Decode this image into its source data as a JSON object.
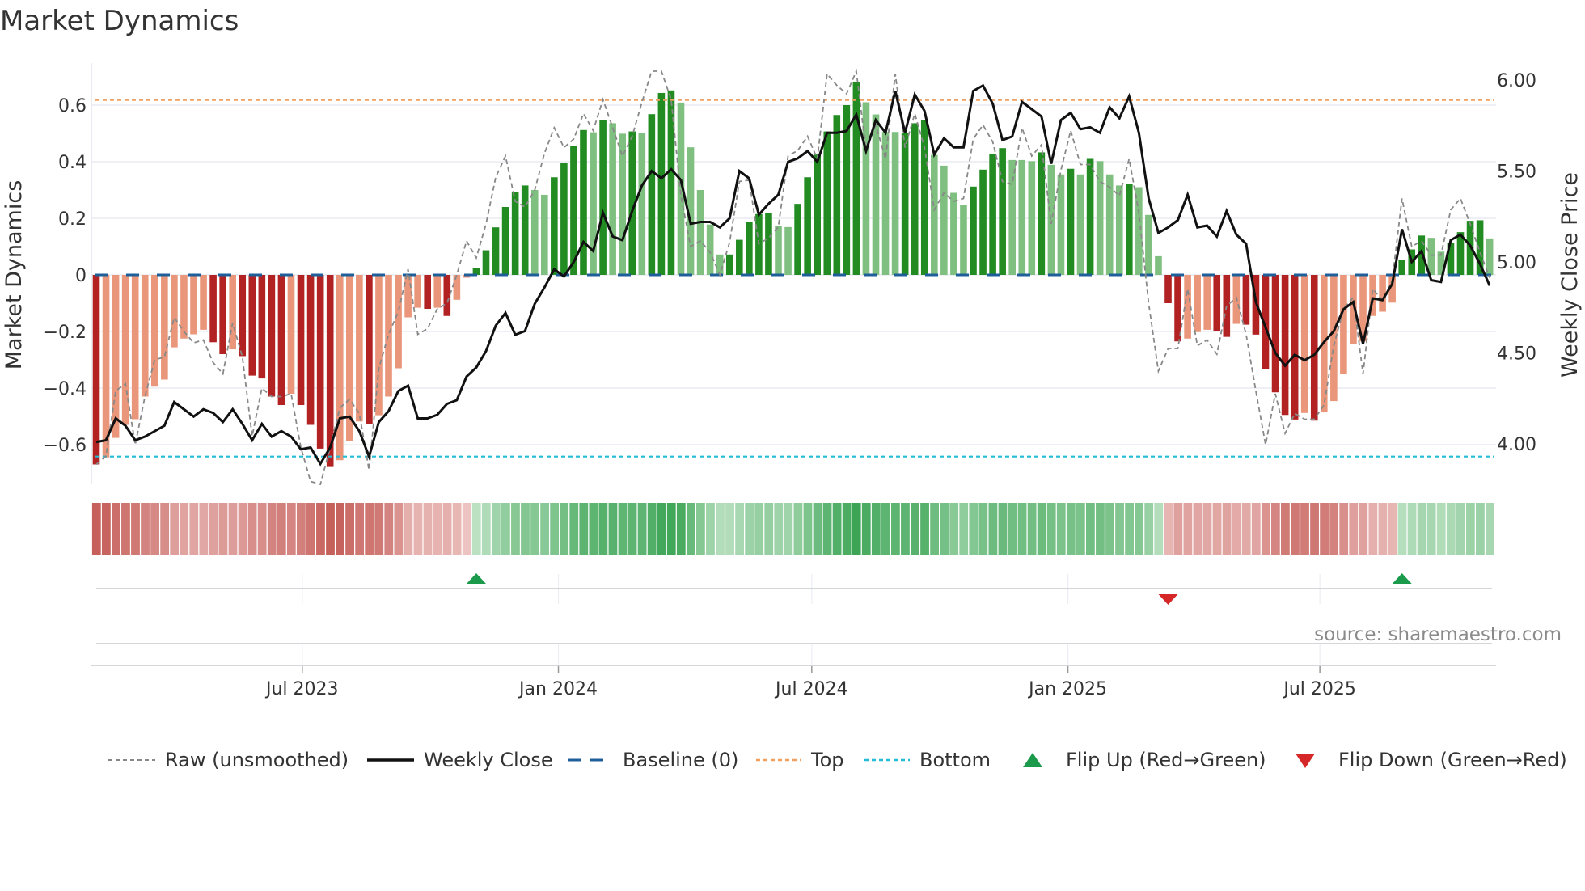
{
  "title": "Market Dynamics",
  "source": "source: sharemaestro.com",
  "chart_data": {
    "type": "bar",
    "title": "Market Dynamics",
    "frequency": "weekly",
    "start_date": "2023-02-03",
    "ylabel": "Market Dynamics",
    "y2label": "Weekly Close Price",
    "ylim": [
      -0.75,
      0.75
    ],
    "y2lim": [
      3.82,
      6.1
    ],
    "yticks": [
      {
        "v": 0.6,
        "label": "0.6"
      },
      {
        "v": 0.4,
        "label": "0.4"
      },
      {
        "v": 0.2,
        "label": "0.2"
      },
      {
        "v": 0,
        "label": "0"
      },
      {
        "v": -0.2,
        "label": "−0.2"
      },
      {
        "v": -0.4,
        "label": "−0.4"
      },
      {
        "v": -0.6,
        "label": "−0.6"
      }
    ],
    "y2ticks": [
      {
        "v": 6.0,
        "label": "6.00"
      },
      {
        "v": 5.5,
        "label": "5.50"
      },
      {
        "v": 5.0,
        "label": "5.00"
      },
      {
        "v": 4.5,
        "label": "4.50"
      },
      {
        "v": 4.0,
        "label": "4.00"
      }
    ],
    "xticks": [
      {
        "date": "2023-07-01",
        "label": "Jul 2023"
      },
      {
        "date": "2024-01-01",
        "label": "Jan 2024"
      },
      {
        "date": "2024-07-01",
        "label": "Jul 2024"
      },
      {
        "date": "2025-01-01",
        "label": "Jan 2025"
      },
      {
        "date": "2025-07-01",
        "label": "Jul 2025"
      }
    ],
    "top_level": 0.618,
    "bottom_level": -0.642,
    "baseline": 0,
    "momentum": [
      -0.67,
      -0.645,
      -0.576,
      -0.53,
      -0.51,
      -0.43,
      -0.395,
      -0.37,
      -0.256,
      -0.225,
      -0.21,
      -0.194,
      -0.238,
      -0.28,
      -0.263,
      -0.287,
      -0.356,
      -0.366,
      -0.43,
      -0.46,
      -0.42,
      -0.46,
      -0.53,
      -0.614,
      -0.676,
      -0.655,
      -0.586,
      -0.518,
      -0.527,
      -0.496,
      -0.43,
      -0.33,
      -0.15,
      -0.116,
      -0.12,
      -0.116,
      -0.145,
      -0.088,
      -0.01,
      0.024,
      0.087,
      0.168,
      0.24,
      0.294,
      0.316,
      0.3,
      0.283,
      0.345,
      0.397,
      0.456,
      0.512,
      0.504,
      0.546,
      0.536,
      0.499,
      0.507,
      0.502,
      0.568,
      0.643,
      0.652,
      0.609,
      0.451,
      0.3,
      0.178,
      0.072,
      0.072,
      0.124,
      0.186,
      0.215,
      0.22,
      0.173,
      0.169,
      0.251,
      0.345,
      0.426,
      0.507,
      0.565,
      0.6,
      0.681,
      0.61,
      0.567,
      0.505,
      0.505,
      0.502,
      0.536,
      0.546,
      0.424,
      0.386,
      0.29,
      0.247,
      0.312,
      0.372,
      0.426,
      0.448,
      0.406,
      0.406,
      0.402,
      0.433,
      0.389,
      0.355,
      0.375,
      0.355,
      0.41,
      0.402,
      0.355,
      0.316,
      0.32,
      0.31,
      0.212,
      0.066,
      -0.1,
      -0.235,
      -0.225,
      -0.202,
      -0.194,
      -0.199,
      -0.219,
      -0.173,
      -0.176,
      -0.211,
      -0.333,
      -0.415,
      -0.495,
      -0.511,
      -0.488,
      -0.515,
      -0.486,
      -0.446,
      -0.351,
      -0.243,
      -0.235,
      -0.145,
      -0.13,
      -0.098,
      0.053,
      0.09,
      0.139,
      0.131,
      0.082,
      0.112,
      0.151,
      0.191,
      0.193,
      0.129
    ],
    "strong": [
      1,
      0,
      0,
      0,
      0,
      0,
      0,
      0,
      0,
      0,
      0,
      0,
      1,
      1,
      0,
      1,
      1,
      1,
      1,
      1,
      0,
      1,
      1,
      1,
      1,
      0,
      0,
      0,
      1,
      0,
      0,
      0,
      0,
      0,
      1,
      0,
      1,
      0,
      0,
      1,
      1,
      1,
      1,
      1,
      1,
      0,
      0,
      1,
      1,
      1,
      1,
      0,
      1,
      0,
      0,
      1,
      0,
      1,
      1,
      1,
      0,
      0,
      0,
      0,
      0,
      1,
      1,
      1,
      1,
      1,
      0,
      0,
      1,
      1,
      1,
      1,
      1,
      1,
      1,
      0,
      0,
      0,
      0,
      1,
      1,
      1,
      0,
      0,
      0,
      0,
      1,
      1,
      1,
      1,
      0,
      0,
      0,
      1,
      0,
      0,
      1,
      0,
      1,
      0,
      0,
      0,
      1,
      0,
      0,
      0,
      1,
      1,
      0,
      0,
      0,
      1,
      1,
      0,
      1,
      1,
      1,
      1,
      1,
      1,
      0,
      1,
      0,
      0,
      0,
      0,
      0,
      0,
      0,
      0,
      1,
      1,
      1,
      0,
      0,
      1,
      1,
      1,
      1,
      0
    ],
    "raw": [
      -0.67,
      -0.64,
      -0.41,
      -0.385,
      -0.6,
      -0.43,
      -0.3,
      -0.29,
      -0.15,
      -0.2,
      -0.24,
      -0.23,
      -0.31,
      -0.35,
      -0.17,
      -0.29,
      -0.57,
      -0.4,
      -0.43,
      -0.43,
      -0.42,
      -0.61,
      -0.73,
      -0.74,
      -0.61,
      -0.47,
      -0.44,
      -0.49,
      -0.69,
      -0.33,
      -0.21,
      -0.13,
      0.02,
      -0.21,
      -0.19,
      -0.12,
      -0.1,
      0,
      0.12,
      0.06,
      0.18,
      0.345,
      0.42,
      0.26,
      0.24,
      0.3,
      0.43,
      0.52,
      0.45,
      0.48,
      0.57,
      0.51,
      0.62,
      0.52,
      0.42,
      0.49,
      0.61,
      0.72,
      0.72,
      0.62,
      0.28,
      0.1,
      0.12,
      0.08,
      0,
      0.115,
      0.33,
      0.335,
      0.11,
      0.13,
      0.17,
      0.42,
      0.44,
      0.49,
      0.41,
      0.71,
      0.67,
      0.64,
      0.72,
      0.44,
      0.53,
      0.41,
      0.71,
      0.45,
      0.57,
      0.45,
      0.23,
      0.29,
      0.26,
      0.27,
      0.48,
      0.53,
      0.47,
      0.33,
      0.32,
      0.52,
      0.42,
      0.46,
      0.18,
      0.37,
      0.51,
      0.39,
      0.39,
      0.33,
      0.31,
      0.28,
      0.41,
      0.22,
      -0.1,
      -0.34,
      -0.26,
      -0.26,
      -0.05,
      -0.25,
      -0.23,
      -0.28,
      -0.11,
      -0.08,
      -0.21,
      -0.41,
      -0.6,
      -0.42,
      -0.56,
      -0.49,
      -0.51,
      -0.51,
      -0.46,
      -0.25,
      -0.12,
      -0.08,
      -0.35,
      -0.05,
      -0.09,
      -0.02,
      0.27,
      0.1,
      0.12,
      0.07,
      0.07,
      0.23,
      0.27,
      0.18,
      0.08,
      -0.01
    ],
    "close": [
      4.01,
      4.02,
      4.14,
      4.1,
      4.02,
      4.04,
      4.07,
      4.1,
      4.23,
      4.19,
      4.15,
      4.19,
      4.17,
      4.12,
      4.19,
      4.11,
      4.02,
      4.11,
      4.04,
      4.07,
      4.04,
      3.97,
      3.98,
      3.89,
      3.98,
      4.14,
      4.15,
      4.07,
      3.93,
      4.12,
      4.18,
      4.29,
      4.32,
      4.14,
      4.14,
      4.16,
      4.22,
      4.24,
      4.37,
      4.42,
      4.51,
      4.65,
      4.72,
      4.6,
      4.62,
      4.77,
      4.86,
      4.96,
      4.92,
      5.0,
      5.11,
      5.06,
      5.27,
      5.14,
      5.12,
      5.28,
      5.42,
      5.5,
      5.46,
      5.51,
      5.45,
      5.21,
      5.22,
      5.22,
      5.19,
      5.24,
      5.5,
      5.46,
      5.26,
      5.32,
      5.37,
      5.55,
      5.57,
      5.61,
      5.55,
      5.71,
      5.71,
      5.72,
      5.81,
      5.61,
      5.78,
      5.71,
      5.94,
      5.71,
      5.92,
      5.83,
      5.59,
      5.68,
      5.63,
      5.63,
      5.94,
      5.97,
      5.87,
      5.67,
      5.69,
      5.88,
      5.84,
      5.8,
      5.54,
      5.78,
      5.82,
      5.73,
      5.74,
      5.71,
      5.85,
      5.79,
      5.91,
      5.71,
      5.35,
      5.16,
      5.19,
      5.23,
      5.37,
      5.19,
      5.2,
      5.14,
      5.28,
      5.15,
      5.1,
      4.78,
      4.64,
      4.5,
      4.43,
      4.49,
      4.46,
      4.49,
      4.56,
      4.62,
      4.74,
      4.78,
      4.55,
      4.8,
      4.79,
      4.88,
      5.18,
      5.0,
      5.06,
      4.9,
      4.89,
      5.12,
      5.15,
      5.09,
      4.99,
      4.87
    ],
    "flips": [
      {
        "week": 40,
        "type": "up"
      },
      {
        "week": 111,
        "type": "down"
      },
      {
        "week": 135,
        "type": "up"
      }
    ],
    "colors": {
      "strong_neg": "#b22222",
      "weak_neg": "#e9967a",
      "strong_pos": "#228b22",
      "weak_pos": "#7fbf7f",
      "close": "#111111",
      "raw": "#888888",
      "baseline": "#1f5f99",
      "top": "#f0a060",
      "bottom": "#22bcd6",
      "flip_up": "#1a9a4a",
      "flip_down": "#d62728"
    },
    "legend": {
      "raw": "Raw (unsmoothed)",
      "close": "Weekly Close",
      "baseline": "Baseline (0)",
      "top": "Top",
      "bottom": "Bottom",
      "flip_up": "Flip Up (Red→Green)",
      "flip_down": "Flip Down (Green→Red)"
    },
    "legend_placement": "bottom",
    "grid": true
  }
}
